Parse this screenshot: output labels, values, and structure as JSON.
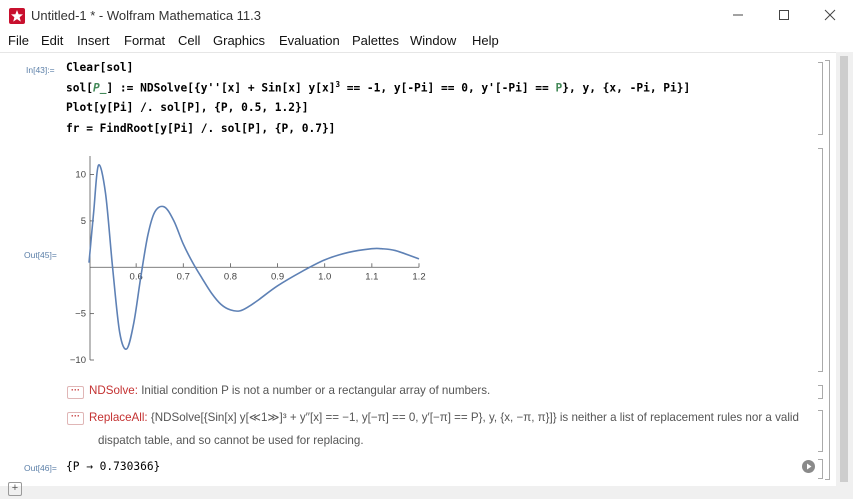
{
  "window": {
    "title": "Untitled-1 * - Wolfram Mathematica 11.3",
    "accent": "#c8102e"
  },
  "menu": [
    "File",
    "Edit",
    "Insert",
    "Format",
    "Cell",
    "Graphics",
    "Evaluation",
    "Palettes",
    "Window",
    "Help"
  ],
  "input_cell": {
    "label": "In[43]:=",
    "lines": [
      [
        {
          "t": "Clear[sol]"
        }
      ],
      [
        {
          "t": "sol["
        },
        {
          "t": "P_",
          "c": "pat"
        },
        {
          "t": "] := NDSolve[{y''[x] + Sin[x] y[x]"
        },
        {
          "t": "3",
          "c": "sup"
        },
        {
          "t": " == -1, y[-Pi] == 0, y'[-Pi] == "
        },
        {
          "t": "P",
          "c": "loc"
        },
        {
          "t": "}, y, {x, -Pi, Pi}]"
        }
      ],
      [
        {
          "t": "Plot[y[Pi] /. sol[P], {P, 0.5, 1.2}]"
        }
      ],
      [
        {
          "t": "fr = FindRoot[y[Pi] /. sol[P], {P, 0.7}]"
        }
      ]
    ]
  },
  "plot_cell": {
    "label": "Out[45]=",
    "line_color": "#5e81b5"
  },
  "chart_data": {
    "type": "line",
    "xlim": [
      0.5,
      1.2
    ],
    "ylim": [
      -10,
      12
    ],
    "x_ticks": [
      "0.6",
      "0.7",
      "0.8",
      "0.9",
      "1.0",
      "1.1",
      "1.2"
    ],
    "x_tick_values": [
      0.6,
      0.7,
      0.8,
      0.9,
      1.0,
      1.1,
      1.2
    ],
    "y_ticks": [
      "10",
      "5",
      "−5",
      "−10"
    ],
    "y_tick_values": [
      10,
      5,
      -5,
      -10
    ],
    "x": [
      0.5,
      0.51,
      0.52,
      0.535,
      0.55,
      0.565,
      0.58,
      0.595,
      0.61,
      0.625,
      0.64,
      0.66,
      0.68,
      0.7,
      0.72,
      0.74,
      0.76,
      0.78,
      0.8,
      0.82,
      0.84,
      0.86,
      0.9,
      0.95,
      1.0,
      1.05,
      1.1,
      1.12,
      1.15,
      1.2
    ],
    "y": [
      0.5,
      6,
      11,
      8,
      0,
      -7,
      -8.8,
      -6,
      -1,
      3.5,
      6,
      6.5,
      5,
      2.5,
      0.5,
      -1.2,
      -2.8,
      -4,
      -4.6,
      -4.7,
      -4.2,
      -3.5,
      -2,
      -0.5,
      0.8,
      1.6,
      2,
      2,
      1.8,
      0.9
    ]
  },
  "messages": [
    {
      "dots": "···",
      "name": "NDSolve:",
      "text": " Initial condition P is not a number or a rectangular array of numbers."
    },
    {
      "dots": "···",
      "name": "ReplaceAll:",
      "text": " {NDSolve[{Sin[x] y[≪1≫]³ + y′′[x] == −1, y[−π] == 0, y′[−π] == P}, y, {x, −π, π}]} is neither a list of replacement rules nor a valid",
      "text2": "dispatch table, and so cannot be used for replacing."
    }
  ],
  "output_cell": {
    "label": "Out[46]=",
    "value": "{P → 0.730366}"
  }
}
